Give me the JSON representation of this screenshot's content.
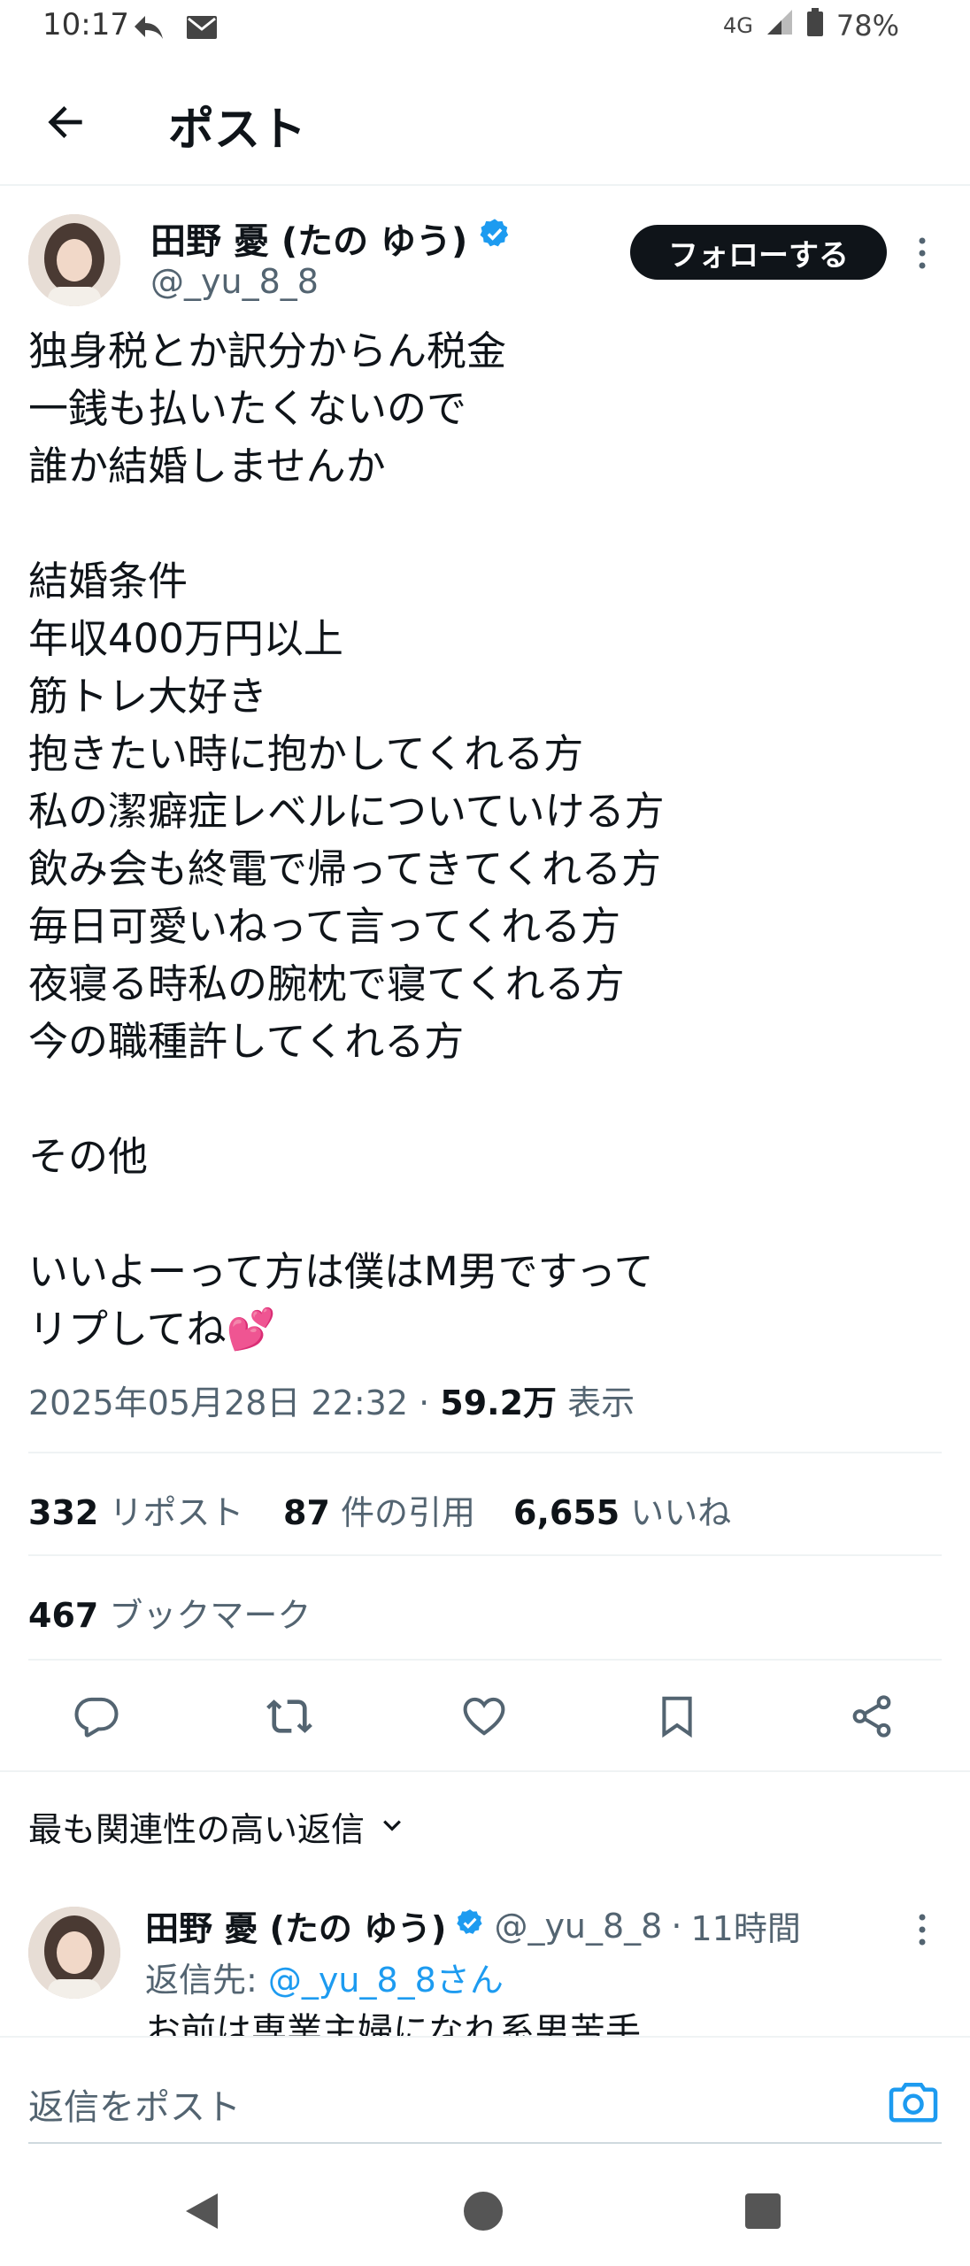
{
  "status_bar": {
    "time": "10:17",
    "network": "4G",
    "battery": "78%"
  },
  "header": {
    "title": "ポスト"
  },
  "post": {
    "author_name": "田野 憂 (たの ゆう)",
    "handle": "@_yu_8_8",
    "follow_label": "フォローする",
    "text": "独身税とか訳分からん税金\n一銭も払いたくないので\n誰か結婚しませんか\n\n結婚条件\n年収400万円以上\n筋トレ大好き\n抱きたい時に抱かしてくれる方\n私の潔癖症レベルについていける方\n飲み会も終電で帰ってきてくれる方\n毎日可愛いねって言ってくれる方\n夜寝る時私の腕枕で寝てくれる方\n今の職種許してくれる方\n\nその他\n\nいいよーって方は僕はM男ですって\nリプしてね💕",
    "timestamp": "2025年05月28日 22:32 · ",
    "views_count": "59.2万",
    "views_label": " 表示"
  },
  "stats": {
    "reposts_count": "332",
    "reposts_label": " リポスト",
    "quotes_count": "87",
    "quotes_label": " 件の引用",
    "likes_count": "6,655",
    "likes_label": " いいね",
    "bookmarks_count": "467",
    "bookmarks_label": " ブックマーク"
  },
  "replies": {
    "sort_label": "最も関連性の高い返信",
    "items": [
      {
        "author_name": "田野 憂 (たの ゆう)",
        "handle": "@_yu_8_8",
        "separator": " · ",
        "time": "11時間",
        "reply_to_label": "返信先: ",
        "reply_to_handle": "@_yu_8_8さん",
        "text": "お前は専業主婦になれ系男苦手"
      }
    ]
  },
  "composer": {
    "placeholder": "返信をポスト"
  },
  "icons": [
    "back-arrow-icon",
    "verified-badge-icon",
    "more-icon",
    "reply-icon",
    "repost-icon",
    "like-icon",
    "bookmark-icon",
    "share-icon",
    "chevron-down-icon",
    "camera-icon",
    "nav-back-icon",
    "nav-home-icon",
    "nav-recents-icon"
  ],
  "colors": {
    "accent": "#1d9bf0",
    "text": "#0f1419",
    "secondary": "#536471"
  }
}
